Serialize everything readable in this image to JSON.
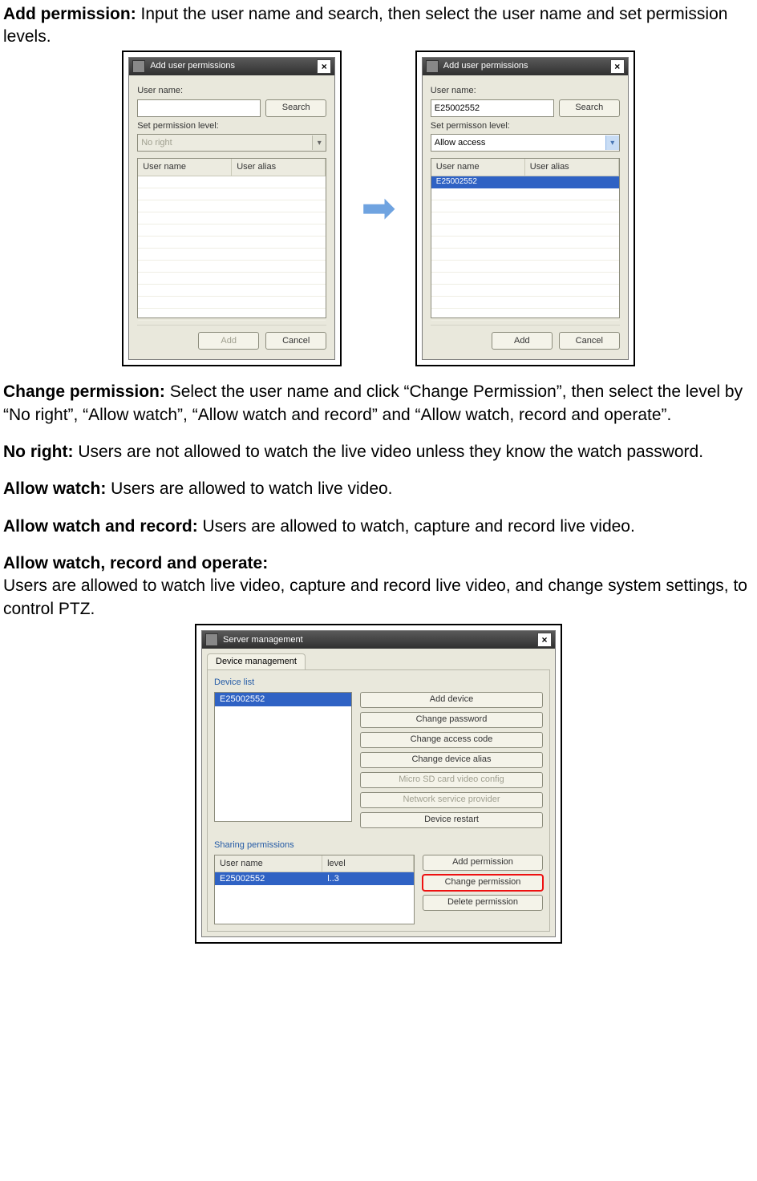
{
  "doc": {
    "add_perm_label": "Add permission:",
    "add_perm_text": " Input the user name and search, then select the user name and set permission levels.",
    "change_perm_label": "Change permission:",
    "change_perm_text": " Select the user name and click “Change Permission”, then select the level by “No right”, “Allow watch”, “Allow watch and record” and “Allow watch, record and operate”.",
    "noright_label": "No right:",
    "noright_text": " Users are not allowed to watch the live video unless they know the watch password.",
    "allowwatch_label": "Allow watch:",
    "allowwatch_text": " Users are allowed to watch live video.",
    "allowrec_label": "Allow watch and record:",
    "allowrec_text": " Users are allowed to watch, capture and record live video.",
    "allowop_label": "Allow watch, record and operate:",
    "allowop_text": "Users are allowed to watch live video, capture and record live video, and change system settings, to control PTZ."
  },
  "dlg1": {
    "title": "Add user permissions",
    "username_label": "User name:",
    "username_value": "",
    "search": "Search",
    "setperm_label": "Set permission level:",
    "setperm_value": "No right",
    "col_user": "User name",
    "col_alias": "User alias",
    "add": "Add",
    "cancel": "Cancel"
  },
  "dlg2": {
    "title": "Add user permissions",
    "username_label": "User name:",
    "username_value": "E25002552",
    "search": "Search",
    "setperm_label": "Set permisson level:",
    "setperm_value": "Allow access",
    "col_user": "User name",
    "col_alias": "User alias",
    "row_user": "E25002552",
    "add": "Add",
    "cancel": "Cancel"
  },
  "dlg3": {
    "title": "Server management",
    "tab": "Device management",
    "devlist_title": "Device list",
    "device_selected": "E25002552",
    "btns": {
      "add_device": "Add device",
      "change_password": "Change password",
      "change_code": "Change access code",
      "change_alias": "Change device alias",
      "sd_config": "Micro SD card video config",
      "net_provider": "Network service provider",
      "restart": "Device restart"
    },
    "sharing_title": "Sharing permissions",
    "col_user": "User name",
    "col_level": "level",
    "row_user": "E25002552",
    "row_level": "l..3",
    "pbtns": {
      "add": "Add permission",
      "change": "Change permission",
      "delete": "Delete permission"
    }
  }
}
